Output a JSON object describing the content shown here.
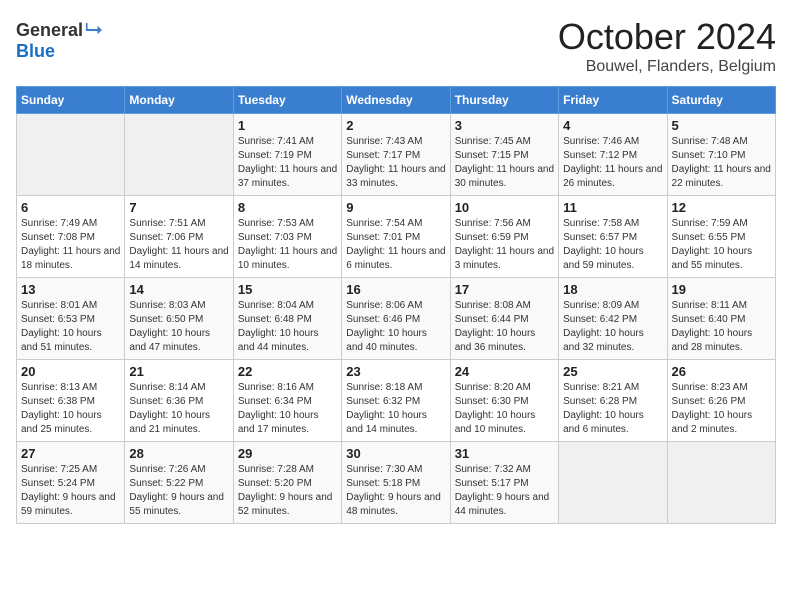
{
  "header": {
    "logo_general": "General",
    "logo_blue": "Blue",
    "month_title": "October 2024",
    "location": "Bouwel, Flanders, Belgium"
  },
  "days_of_week": [
    "Sunday",
    "Monday",
    "Tuesday",
    "Wednesday",
    "Thursday",
    "Friday",
    "Saturday"
  ],
  "weeks": [
    [
      {
        "day": "",
        "sunrise": "",
        "sunset": "",
        "daylight": ""
      },
      {
        "day": "",
        "sunrise": "",
        "sunset": "",
        "daylight": ""
      },
      {
        "day": "1",
        "sunrise": "Sunrise: 7:41 AM",
        "sunset": "Sunset: 7:19 PM",
        "daylight": "Daylight: 11 hours and 37 minutes."
      },
      {
        "day": "2",
        "sunrise": "Sunrise: 7:43 AM",
        "sunset": "Sunset: 7:17 PM",
        "daylight": "Daylight: 11 hours and 33 minutes."
      },
      {
        "day": "3",
        "sunrise": "Sunrise: 7:45 AM",
        "sunset": "Sunset: 7:15 PM",
        "daylight": "Daylight: 11 hours and 30 minutes."
      },
      {
        "day": "4",
        "sunrise": "Sunrise: 7:46 AM",
        "sunset": "Sunset: 7:12 PM",
        "daylight": "Daylight: 11 hours and 26 minutes."
      },
      {
        "day": "5",
        "sunrise": "Sunrise: 7:48 AM",
        "sunset": "Sunset: 7:10 PM",
        "daylight": "Daylight: 11 hours and 22 minutes."
      }
    ],
    [
      {
        "day": "6",
        "sunrise": "Sunrise: 7:49 AM",
        "sunset": "Sunset: 7:08 PM",
        "daylight": "Daylight: 11 hours and 18 minutes."
      },
      {
        "day": "7",
        "sunrise": "Sunrise: 7:51 AM",
        "sunset": "Sunset: 7:06 PM",
        "daylight": "Daylight: 11 hours and 14 minutes."
      },
      {
        "day": "8",
        "sunrise": "Sunrise: 7:53 AM",
        "sunset": "Sunset: 7:03 PM",
        "daylight": "Daylight: 11 hours and 10 minutes."
      },
      {
        "day": "9",
        "sunrise": "Sunrise: 7:54 AM",
        "sunset": "Sunset: 7:01 PM",
        "daylight": "Daylight: 11 hours and 6 minutes."
      },
      {
        "day": "10",
        "sunrise": "Sunrise: 7:56 AM",
        "sunset": "Sunset: 6:59 PM",
        "daylight": "Daylight: 11 hours and 3 minutes."
      },
      {
        "day": "11",
        "sunrise": "Sunrise: 7:58 AM",
        "sunset": "Sunset: 6:57 PM",
        "daylight": "Daylight: 10 hours and 59 minutes."
      },
      {
        "day": "12",
        "sunrise": "Sunrise: 7:59 AM",
        "sunset": "Sunset: 6:55 PM",
        "daylight": "Daylight: 10 hours and 55 minutes."
      }
    ],
    [
      {
        "day": "13",
        "sunrise": "Sunrise: 8:01 AM",
        "sunset": "Sunset: 6:53 PM",
        "daylight": "Daylight: 10 hours and 51 minutes."
      },
      {
        "day": "14",
        "sunrise": "Sunrise: 8:03 AM",
        "sunset": "Sunset: 6:50 PM",
        "daylight": "Daylight: 10 hours and 47 minutes."
      },
      {
        "day": "15",
        "sunrise": "Sunrise: 8:04 AM",
        "sunset": "Sunset: 6:48 PM",
        "daylight": "Daylight: 10 hours and 44 minutes."
      },
      {
        "day": "16",
        "sunrise": "Sunrise: 8:06 AM",
        "sunset": "Sunset: 6:46 PM",
        "daylight": "Daylight: 10 hours and 40 minutes."
      },
      {
        "day": "17",
        "sunrise": "Sunrise: 8:08 AM",
        "sunset": "Sunset: 6:44 PM",
        "daylight": "Daylight: 10 hours and 36 minutes."
      },
      {
        "day": "18",
        "sunrise": "Sunrise: 8:09 AM",
        "sunset": "Sunset: 6:42 PM",
        "daylight": "Daylight: 10 hours and 32 minutes."
      },
      {
        "day": "19",
        "sunrise": "Sunrise: 8:11 AM",
        "sunset": "Sunset: 6:40 PM",
        "daylight": "Daylight: 10 hours and 28 minutes."
      }
    ],
    [
      {
        "day": "20",
        "sunrise": "Sunrise: 8:13 AM",
        "sunset": "Sunset: 6:38 PM",
        "daylight": "Daylight: 10 hours and 25 minutes."
      },
      {
        "day": "21",
        "sunrise": "Sunrise: 8:14 AM",
        "sunset": "Sunset: 6:36 PM",
        "daylight": "Daylight: 10 hours and 21 minutes."
      },
      {
        "day": "22",
        "sunrise": "Sunrise: 8:16 AM",
        "sunset": "Sunset: 6:34 PM",
        "daylight": "Daylight: 10 hours and 17 minutes."
      },
      {
        "day": "23",
        "sunrise": "Sunrise: 8:18 AM",
        "sunset": "Sunset: 6:32 PM",
        "daylight": "Daylight: 10 hours and 14 minutes."
      },
      {
        "day": "24",
        "sunrise": "Sunrise: 8:20 AM",
        "sunset": "Sunset: 6:30 PM",
        "daylight": "Daylight: 10 hours and 10 minutes."
      },
      {
        "day": "25",
        "sunrise": "Sunrise: 8:21 AM",
        "sunset": "Sunset: 6:28 PM",
        "daylight": "Daylight: 10 hours and 6 minutes."
      },
      {
        "day": "26",
        "sunrise": "Sunrise: 8:23 AM",
        "sunset": "Sunset: 6:26 PM",
        "daylight": "Daylight: 10 hours and 2 minutes."
      }
    ],
    [
      {
        "day": "27",
        "sunrise": "Sunrise: 7:25 AM",
        "sunset": "Sunset: 5:24 PM",
        "daylight": "Daylight: 9 hours and 59 minutes."
      },
      {
        "day": "28",
        "sunrise": "Sunrise: 7:26 AM",
        "sunset": "Sunset: 5:22 PM",
        "daylight": "Daylight: 9 hours and 55 minutes."
      },
      {
        "day": "29",
        "sunrise": "Sunrise: 7:28 AM",
        "sunset": "Sunset: 5:20 PM",
        "daylight": "Daylight: 9 hours and 52 minutes."
      },
      {
        "day": "30",
        "sunrise": "Sunrise: 7:30 AM",
        "sunset": "Sunset: 5:18 PM",
        "daylight": "Daylight: 9 hours and 48 minutes."
      },
      {
        "day": "31",
        "sunrise": "Sunrise: 7:32 AM",
        "sunset": "Sunset: 5:17 PM",
        "daylight": "Daylight: 9 hours and 44 minutes."
      },
      {
        "day": "",
        "sunrise": "",
        "sunset": "",
        "daylight": ""
      },
      {
        "day": "",
        "sunrise": "",
        "sunset": "",
        "daylight": ""
      }
    ]
  ]
}
